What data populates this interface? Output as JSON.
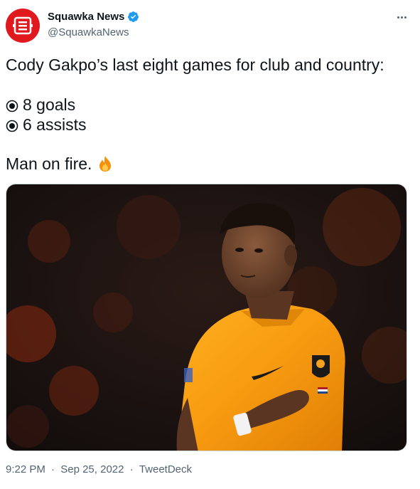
{
  "author": {
    "name": "Squawka News",
    "handle": "@SquawkaNews",
    "verified": true,
    "avatar_icon": "squawka-logo-icon",
    "avatar_color": "#e0191f"
  },
  "tweet": {
    "line1": "Cody Gakpo’s last eight games for club and country:",
    "stat1": "8 goals",
    "stat2": "6 assists",
    "closing": "Man on fire.",
    "emoji": "🔥"
  },
  "media": {
    "alt_icon": "football-player-photo"
  },
  "meta": {
    "time": "9:22 PM",
    "date": "Sep 25, 2022",
    "source": "TweetDeck"
  },
  "colors": {
    "verified": "#1d9bf0",
    "text": "#0f1419",
    "muted": "#536471"
  }
}
